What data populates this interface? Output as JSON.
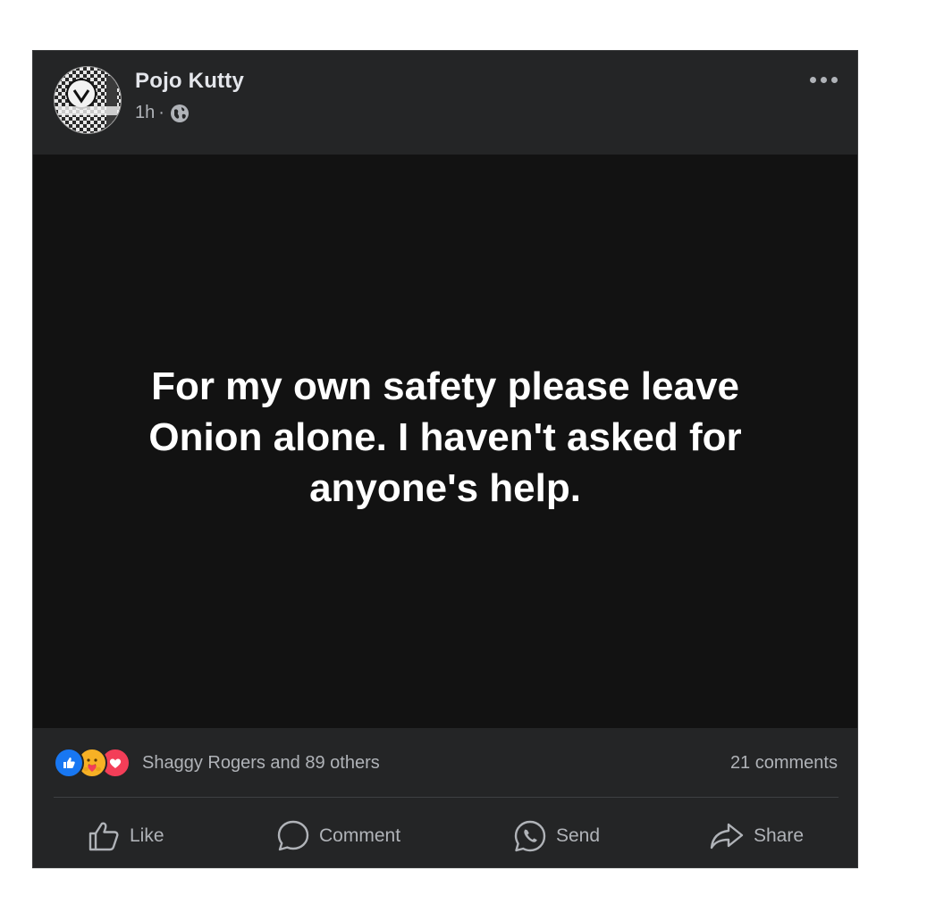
{
  "post": {
    "author": "Pojo Kutty",
    "time": "1h",
    "separator": "·",
    "privacy_icon": "globe-icon",
    "text": "For my own safety please leave Onion alone. I haven't asked for anyone's help.",
    "background_color": "#121212"
  },
  "reactions": {
    "icons": [
      "like-reaction-icon",
      "care-reaction-icon",
      "love-reaction-icon"
    ],
    "summary": "Shaggy Rogers and 89 others",
    "comments": "21 comments"
  },
  "actions": {
    "like": "Like",
    "comment": "Comment",
    "send": "Send",
    "share": "Share"
  },
  "colors": {
    "card_bg": "#242526",
    "text_secondary": "#b0b3b8",
    "like_blue": "#1877f2",
    "love_red": "#f33e58",
    "care_yellow": "#f7b125"
  }
}
